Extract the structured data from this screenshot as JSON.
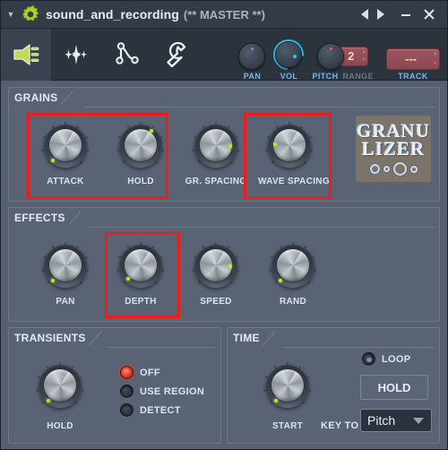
{
  "titlebar": {
    "caret_icon": "caret-down-icon",
    "gear_icon": "gear-icon",
    "title": "sound_and_recording",
    "subtitle": "(** MASTER **)",
    "prev_icon": "arrow-left-icon",
    "next_icon": "arrow-right-icon",
    "minimize_icon": "minimize-icon",
    "close_icon": "close-icon"
  },
  "toolbar": {
    "buttons": [
      {
        "icon": "speaker-plug-icon",
        "active": true
      },
      {
        "icon": "waveform-icon",
        "active": false
      },
      {
        "icon": "envelope-points-icon",
        "active": false
      },
      {
        "icon": "wrench-icon",
        "active": false
      }
    ],
    "pan": {
      "label": "PAN"
    },
    "vol": {
      "label": "VOL"
    },
    "pitch": {
      "label": "PITCH"
    },
    "range": {
      "label": "RANGE",
      "value": "2"
    },
    "track": {
      "label": "TRACK",
      "value": "---"
    }
  },
  "grains": {
    "title": "GRAINS",
    "knobs": [
      {
        "label": "ATTACK",
        "highlighted": true
      },
      {
        "label": "HOLD",
        "highlighted": true
      },
      {
        "label": "GR. SPACING",
        "highlighted": false
      },
      {
        "label": "WAVE SPACING",
        "highlighted": true
      }
    ],
    "logo_line1": "GRANU",
    "logo_line2": "LIZER"
  },
  "effects": {
    "title": "EFFECTS",
    "knobs": [
      {
        "label": "PAN",
        "highlighted": false
      },
      {
        "label": "DEPTH",
        "highlighted": true
      },
      {
        "label": "SPEED",
        "highlighted": false
      },
      {
        "label": "RAND",
        "highlighted": false
      }
    ]
  },
  "transients": {
    "title": "TRANSIENTS",
    "knob_label": "HOLD",
    "options": [
      {
        "label": "OFF",
        "selected": true
      },
      {
        "label": "USE REGION",
        "selected": false
      },
      {
        "label": "DETECT",
        "selected": false
      }
    ]
  },
  "time": {
    "title": "TIME",
    "knob_label": "START",
    "loop_label": "LOOP",
    "hold_button": "HOLD",
    "key_to_label": "KEY TO",
    "dropdown_value": "Pitch"
  },
  "colors": {
    "highlight": "#ee1c1c",
    "accent_blue": "#74b8e8",
    "led_green": "#bfe63a",
    "vol_arc": "#30c3f0",
    "red_box": "#a05560"
  }
}
